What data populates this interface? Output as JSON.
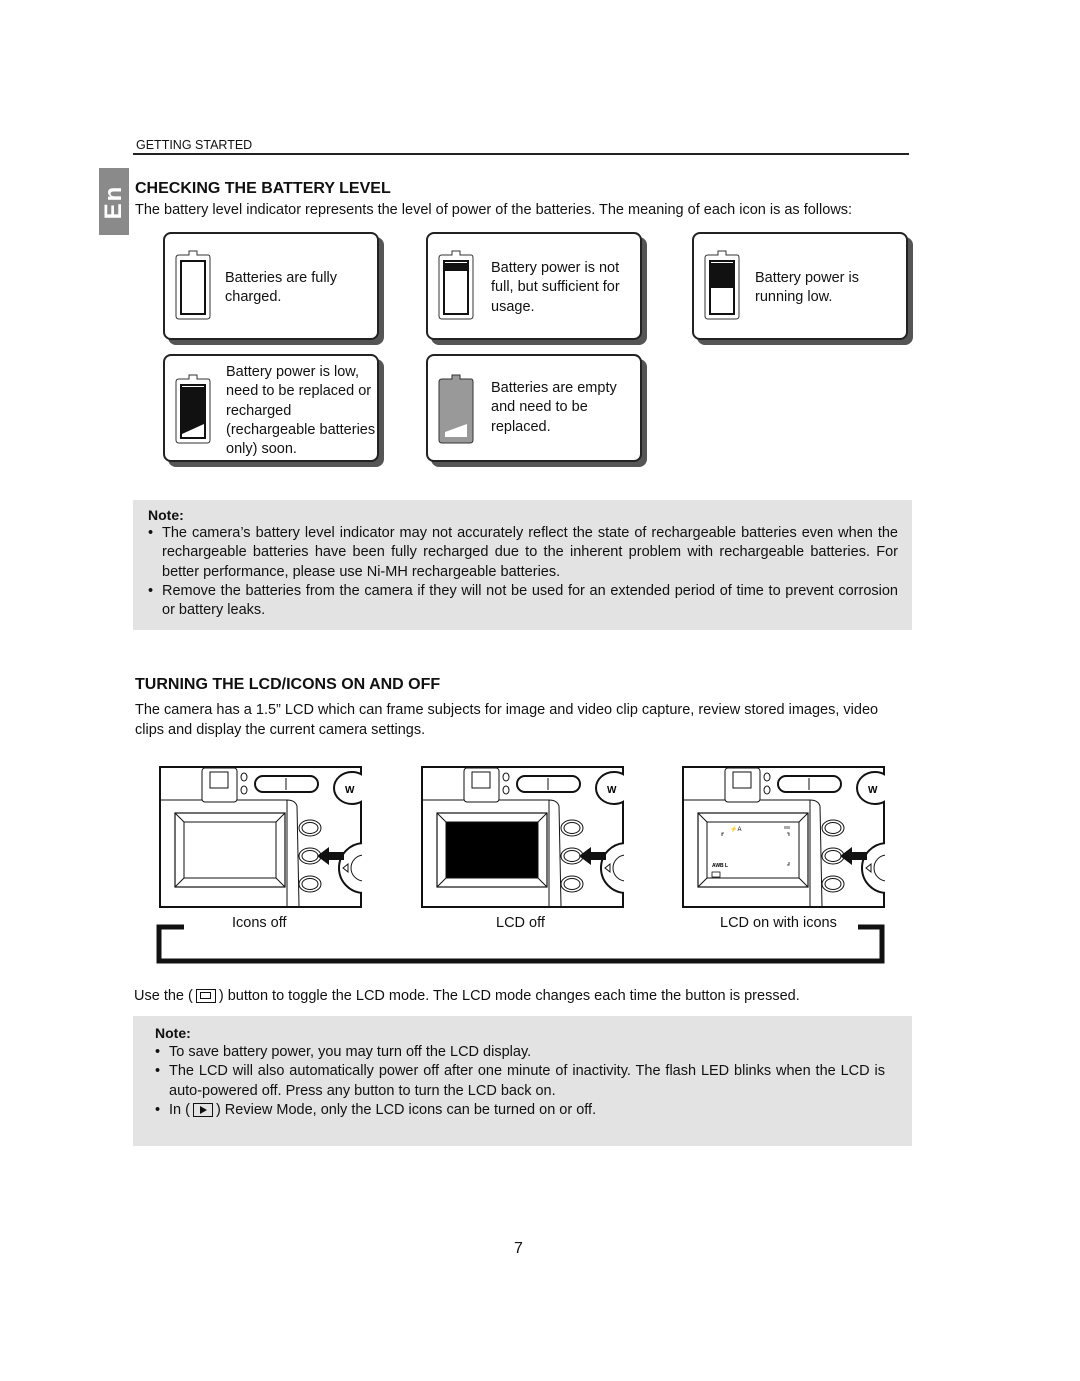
{
  "header": {
    "section": "GETTING STARTED",
    "language_tab": "En"
  },
  "battery": {
    "title": "CHECKING THE BATTERY LEVEL",
    "intro": "The battery level indicator represents the level of power of the batteries. The meaning of each icon is as follows:",
    "levels": [
      {
        "level": "full",
        "text": "Batteries are fully charged."
      },
      {
        "level": "not-full",
        "text": "Battery power is not full, but sufficient for usage."
      },
      {
        "level": "running-low",
        "text": "Battery power is running low."
      },
      {
        "level": "low",
        "text": "Battery power is low, need to be replaced or recharged (rechargeable batteries only) soon."
      },
      {
        "level": "empty",
        "text": "Batteries are empty and need to be replaced."
      }
    ],
    "note_label": "Note:",
    "notes": [
      "The camera’s battery level indicator may not accurately reflect the state of rechargeable batteries even when the rechargeable batteries have been fully recharged due to the inherent problem with rechargeable batteries. For better performance, please use Ni-MH rechargeable batteries.",
      "Remove the batteries from the camera if they will not be used for an extended period of time to prevent corrosion or battery leaks."
    ]
  },
  "lcd": {
    "title": "TURNING THE LCD/ICONS ON AND OFF",
    "intro": "The camera has a 1.5” LCD which can frame subjects for image and video clip capture, review stored images, video clips and display the current camera settings.",
    "modes": [
      "Icons off",
      "LCD off",
      "LCD on with icons"
    ],
    "screen_icons": {
      "wb": "AWB",
      "size": "L"
    },
    "toggle_before": "Use the (",
    "toggle_after": ") button to toggle the LCD mode. The LCD mode changes each time the button is pressed.",
    "note_label": "Note:",
    "notes": [
      "To save battery power, you may turn off the LCD display.",
      "The LCD will also automatically power off after one minute of inactivity. The flash LED blinks when the LCD is auto-powered off.  Press any button to turn the LCD back on."
    ],
    "review_before": "In (",
    "review_after": ") Review Mode, only the LCD icons can be turned on or off."
  },
  "page_number": "7"
}
